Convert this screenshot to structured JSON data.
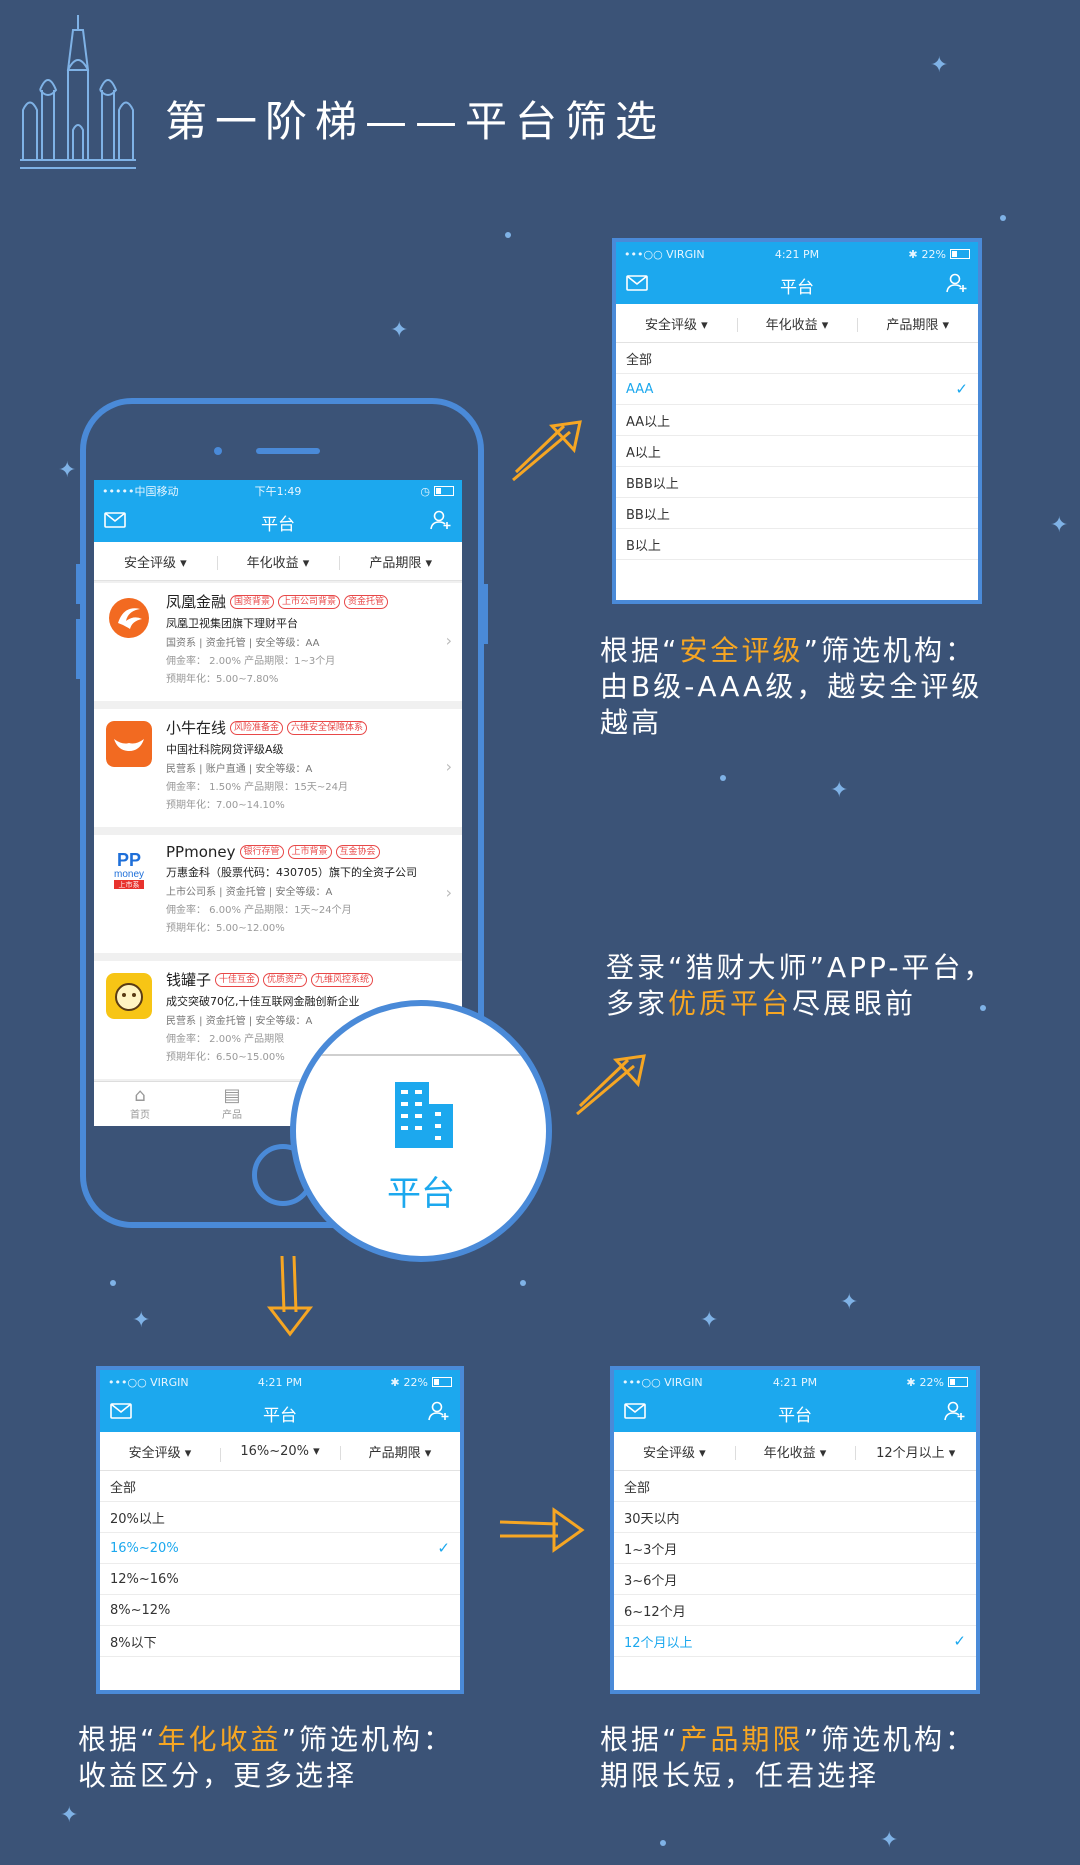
{
  "page": {
    "heading": "第一阶梯——平台筛选"
  },
  "colors": {
    "background": "#3b5377",
    "accent": "#1ca8ee",
    "highlight": "#f6a623",
    "frame": "#4a8ad8",
    "tag_red": "#e84848"
  },
  "panel_top": {
    "status": {
      "carrier": "•••○○ VIRGIN",
      "time": "4:21 PM",
      "battery": "22%"
    },
    "nav": {
      "title": "平台",
      "left_icon": "mail-icon",
      "right_icon": "add-user-icon"
    },
    "filters": [
      "安全评级 ▾",
      "年化收益 ▾",
      "产品期限 ▾"
    ],
    "options": [
      "全部",
      "AAA",
      "AA以上",
      "A以上",
      "BBB以上",
      "BB以上",
      "B以上"
    ],
    "selected": "AAA"
  },
  "panel_left": {
    "status": {
      "carrier": "•••○○ VIRGIN",
      "time": "4:21 PM",
      "battery": "22%"
    },
    "nav": {
      "title": "平台"
    },
    "filters": [
      "安全评级 ▾",
      "16%~20% ▾",
      "产品期限 ▾"
    ],
    "options": [
      "全部",
      "20%以上",
      "16%~20%",
      "12%~16%",
      "8%~12%",
      "8%以下"
    ],
    "selected": "16%~20%"
  },
  "panel_right": {
    "status": {
      "carrier": "•••○○ VIRGIN",
      "time": "4:21 PM",
      "battery": "22%"
    },
    "nav": {
      "title": "平台"
    },
    "filters": [
      "安全评级 ▾",
      "年化收益 ▾",
      "12个月以上 ▾"
    ],
    "options": [
      "全部",
      "30天以内",
      "1~3个月",
      "3~6个月",
      "6~12个月",
      "12个月以上"
    ],
    "selected": "12个月以上"
  },
  "phone": {
    "status": {
      "carrier": "•••••中国移动",
      "time": "下午1:49"
    },
    "nav": {
      "title": "平台"
    },
    "filters": [
      "安全评级 ▾",
      "年化收益 ▾",
      "产品期限 ▾"
    ],
    "cards": [
      {
        "name": "凤凰金融",
        "tags": [
          "国资背景",
          "上市公司背景",
          "资金托管"
        ],
        "desc": "凤凰卫视集团旗下理财平台",
        "meta": "国资系 | 资金托管 | 安全等级：AA",
        "commission": "佣金率：  2.00%      产品期限：1~3个月",
        "yield": "预期年化：5.00~7.80%"
      },
      {
        "name": "小牛在线",
        "tags": [
          "风险准备金",
          "六维安全保障体系"
        ],
        "desc": "中国社科院网贷评级A级",
        "meta": "民营系 | 账户直通 | 安全等级：A",
        "commission": "佣金率：  1.50%      产品期限：15天~24月",
        "yield": "预期年化：7.00~14.10%"
      },
      {
        "name": "PPmoney",
        "tags": [
          "银行存管",
          "上市背景",
          "互金协会"
        ],
        "desc": "万惠金科（股票代码：430705）旗下的全资子公司",
        "meta": "上市公司系 | 资金托管 | 安全等级：A",
        "commission": "佣金率：  6.00%      产品期限：1天~24个月",
        "yield": "预期年化：5.00~12.00%"
      },
      {
        "name": "钱罐子",
        "tags": [
          "十佳互金",
          "优质资产",
          "九维风控系统"
        ],
        "desc": "成交突破70亿,十佳互联网金融创新企业",
        "meta": "民营系 | 资金托管 | 安全等级：A",
        "commission": "佣金率：  2.00%      产品期限",
        "yield": "预期年化：6.50~15.00%"
      }
    ],
    "tabs": [
      "首页",
      "产品",
      "平台"
    ],
    "logo_text": {
      "pp": "PP",
      "money": "money",
      "listed": "上市系"
    }
  },
  "magnifier": {
    "label": "平台",
    "icon": "building-icon"
  },
  "captions": {
    "top": {
      "pre": "根据“",
      "hl": "安全评级",
      "post": "”筛选机构：",
      "line2": "由B级-AAA级，越安全评级",
      "line3": "越高"
    },
    "middle": {
      "line1": "登录“猎财大师”APP-平台，",
      "pre": "多家",
      "hl": "优质平台",
      "post": "尽展眼前"
    },
    "left": {
      "pre": "根据“",
      "hl": "年化收益",
      "post": "”筛选机构：",
      "line2": "收益区分，更多选择"
    },
    "right": {
      "pre": "根据“",
      "hl": "产品期限",
      "post": "”筛选机构：",
      "line2": "期限长短，任君选择"
    }
  }
}
